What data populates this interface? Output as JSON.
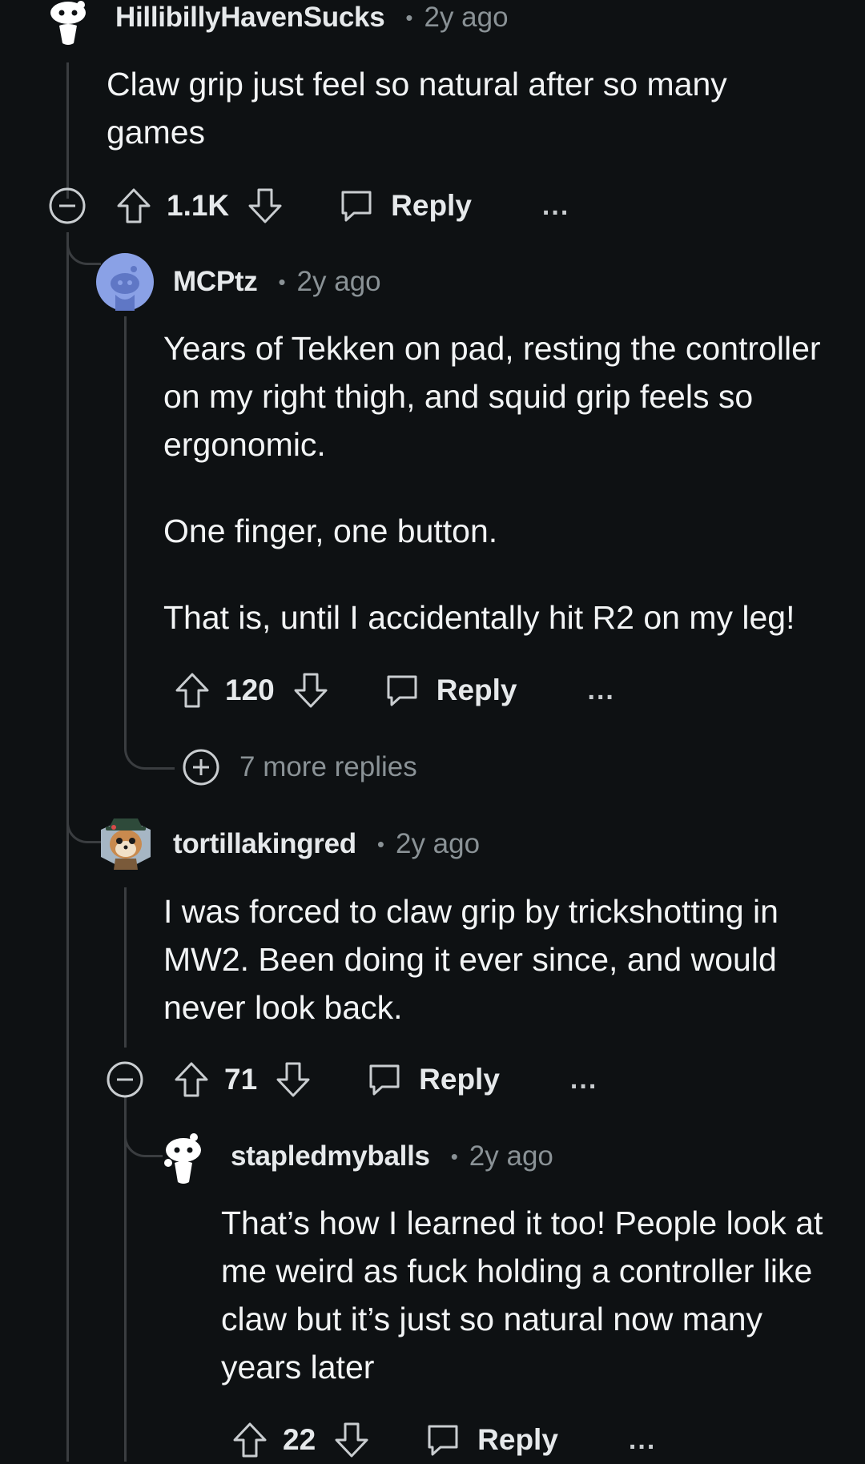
{
  "comments": [
    {
      "username": "HillibillyHavenSucks",
      "time": "2y ago",
      "body": [
        "Claw grip just feel so natural after so many games"
      ],
      "score": "1.1K",
      "reply_label": "Reply",
      "more": "..."
    },
    {
      "username": "MCPtz",
      "time": "2y ago",
      "body": [
        "Years of Tekken on pad, resting the controller on my right thigh, and squid grip feels so ergonomic.",
        "One finger, one button.",
        "That is, until I accidentally hit R2 on my leg!"
      ],
      "score": "120",
      "reply_label": "Reply",
      "more": "...",
      "more_replies": "7 more replies"
    },
    {
      "username": "tortillakingred",
      "time": "2y ago",
      "body": [
        "I was forced to claw grip by trickshotting in MW2. Been doing it ever since, and would never look back."
      ],
      "score": "71",
      "reply_label": "Reply",
      "more": "..."
    },
    {
      "username": "stapledmyballs",
      "time": "2y ago",
      "body": [
        "That’s how I learned it too! People look at me weird as fuck holding a controller like claw but it’s just so natural now many years later"
      ],
      "score": "22",
      "reply_label": "Reply",
      "more": "..."
    }
  ],
  "colors": {
    "background": "#0e1113",
    "thread_line": "#3a3d40",
    "muted_text": "#8a9296",
    "avatar_blue": "#8aa1e6"
  },
  "icons": [
    "snoo-avatar",
    "collapse-icon",
    "upvote-icon",
    "downvote-icon",
    "reply-icon",
    "more-icon",
    "expand-icon"
  ]
}
